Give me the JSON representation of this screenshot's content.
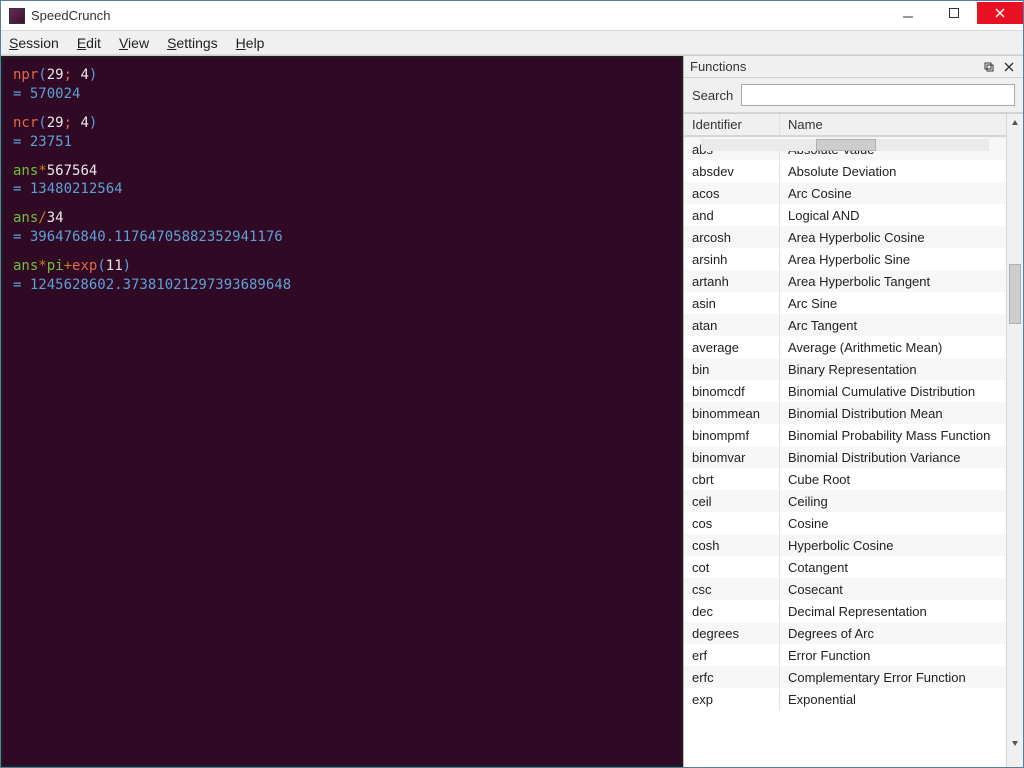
{
  "window": {
    "title": "SpeedCrunch"
  },
  "menu": {
    "items": [
      {
        "key": "S",
        "rest": "ession"
      },
      {
        "key": "E",
        "rest": "dit"
      },
      {
        "key": "V",
        "rest": "iew"
      },
      {
        "key": "S",
        "rest": "ettings"
      },
      {
        "key": "H",
        "rest": "elp"
      }
    ]
  },
  "console": {
    "entries": [
      {
        "tokens": [
          {
            "cls": "tok-fn",
            "t": "npr"
          },
          {
            "cls": "tok-paren",
            "t": "("
          },
          {
            "cls": "tok-num",
            "t": "29"
          },
          {
            "cls": "tok-sep",
            "t": "; "
          },
          {
            "cls": "tok-num",
            "t": "4"
          },
          {
            "cls": "tok-paren",
            "t": ")"
          }
        ],
        "result": "= 570024"
      },
      {
        "tokens": [
          {
            "cls": "tok-fn",
            "t": "ncr"
          },
          {
            "cls": "tok-paren",
            "t": "("
          },
          {
            "cls": "tok-num",
            "t": "29"
          },
          {
            "cls": "tok-sep",
            "t": "; "
          },
          {
            "cls": "tok-num",
            "t": "4"
          },
          {
            "cls": "tok-paren",
            "t": ")"
          }
        ],
        "result": "= 23751"
      },
      {
        "tokens": [
          {
            "cls": "tok-ans",
            "t": "ans"
          },
          {
            "cls": "tok-op",
            "t": "*"
          },
          {
            "cls": "tok-num",
            "t": "567564"
          }
        ],
        "result": "= 13480212564"
      },
      {
        "tokens": [
          {
            "cls": "tok-ans",
            "t": "ans"
          },
          {
            "cls": "tok-op",
            "t": "/"
          },
          {
            "cls": "tok-num",
            "t": "34"
          }
        ],
        "result": "= 396476840.11764705882352941176"
      },
      {
        "tokens": [
          {
            "cls": "tok-ans",
            "t": "ans"
          },
          {
            "cls": "tok-op",
            "t": "*"
          },
          {
            "cls": "tok-var",
            "t": "pi"
          },
          {
            "cls": "tok-op",
            "t": "+"
          },
          {
            "cls": "tok-fn",
            "t": "exp"
          },
          {
            "cls": "tok-paren",
            "t": "("
          },
          {
            "cls": "tok-num",
            "t": "11"
          },
          {
            "cls": "tok-paren",
            "t": ")"
          }
        ],
        "result": "= 1245628602.37381021297393689648"
      }
    ]
  },
  "panel": {
    "title": "Functions",
    "search_label": "Search",
    "search_value": "",
    "columns": {
      "identifier": "Identifier",
      "name": "Name"
    },
    "functions": [
      {
        "id": "abs",
        "name": "Absolute Value"
      },
      {
        "id": "absdev",
        "name": "Absolute Deviation"
      },
      {
        "id": "acos",
        "name": "Arc Cosine"
      },
      {
        "id": "and",
        "name": "Logical AND"
      },
      {
        "id": "arcosh",
        "name": "Area Hyperbolic Cosine"
      },
      {
        "id": "arsinh",
        "name": "Area Hyperbolic Sine"
      },
      {
        "id": "artanh",
        "name": "Area Hyperbolic Tangent"
      },
      {
        "id": "asin",
        "name": "Arc Sine"
      },
      {
        "id": "atan",
        "name": "Arc Tangent"
      },
      {
        "id": "average",
        "name": "Average (Arithmetic Mean)"
      },
      {
        "id": "bin",
        "name": "Binary Representation"
      },
      {
        "id": "binomcdf",
        "name": "Binomial Cumulative Distribution"
      },
      {
        "id": "binommean",
        "name": "Binomial Distribution Mean"
      },
      {
        "id": "binompmf",
        "name": "Binomial Probability Mass Function"
      },
      {
        "id": "binomvar",
        "name": "Binomial Distribution Variance"
      },
      {
        "id": "cbrt",
        "name": "Cube Root"
      },
      {
        "id": "ceil",
        "name": "Ceiling"
      },
      {
        "id": "cos",
        "name": "Cosine"
      },
      {
        "id": "cosh",
        "name": "Hyperbolic Cosine"
      },
      {
        "id": "cot",
        "name": "Cotangent"
      },
      {
        "id": "csc",
        "name": "Cosecant"
      },
      {
        "id": "dec",
        "name": "Decimal Representation"
      },
      {
        "id": "degrees",
        "name": "Degrees of Arc"
      },
      {
        "id": "erf",
        "name": "Error Function"
      },
      {
        "id": "erfc",
        "name": "Complementary Error Function"
      },
      {
        "id": "exp",
        "name": "Exponential"
      }
    ]
  }
}
